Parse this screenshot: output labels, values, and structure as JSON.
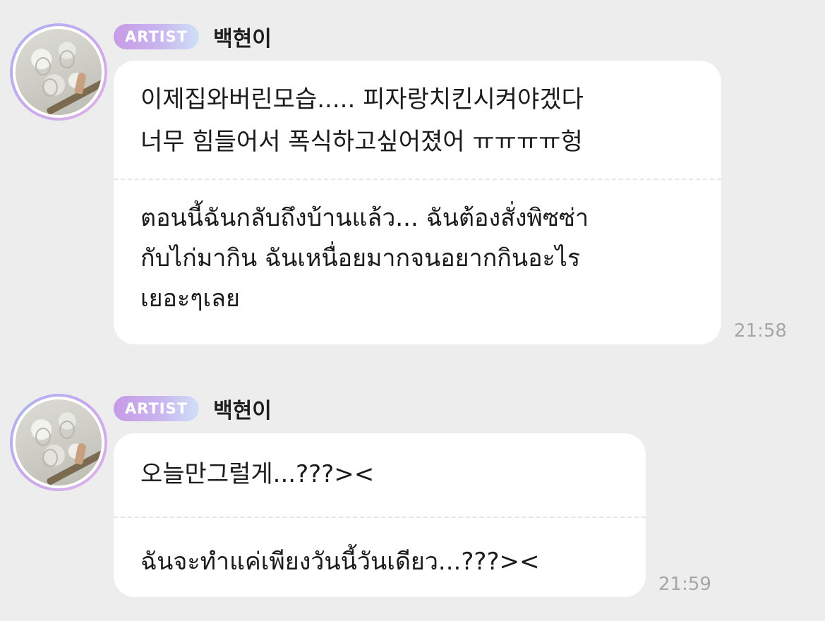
{
  "messages": [
    {
      "badge": "ARTIST",
      "sender": "백현이",
      "original_lines": [
        "이제집와버린모습..... 피자랑치킨시켜야겠다",
        "너무 힘들어서 폭식하고싶어졌어 ㅠㅠㅠㅠ헝"
      ],
      "translation_lines": [
        "ตอนนี้ฉันกลับถึงบ้านแล้ว... ฉันต้องสั่งพิซซ่า",
        "กับไก่มากิน ฉันเหนื่อยมากจนอยากกินอะไร",
        "เยอะๆเลย"
      ],
      "time": "21:58"
    },
    {
      "badge": "ARTIST",
      "sender": "백현이",
      "original_lines": [
        "오늘만그럴게...???><"
      ],
      "translation_lines": [
        "ฉันจะทำแค่เพียงวันนี้วันเดียว...???><"
      ],
      "time": "21:59"
    }
  ]
}
